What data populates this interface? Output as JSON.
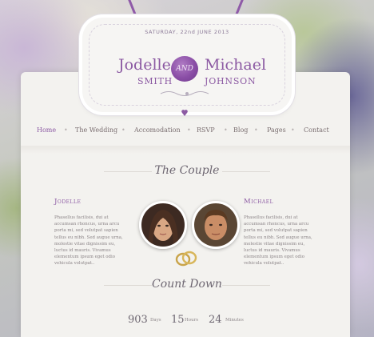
{
  "header": {
    "date": "SATURDAY, 22nd JUNE 2013",
    "bride_first": "Jodelle",
    "bride_last": "SMITH",
    "groom_first": "Michael",
    "groom_last": "JOHNSON",
    "seal_text": "AND",
    "accent_color": "#8c5aa3"
  },
  "nav": {
    "items": [
      "Home",
      "The Wedding",
      "Accomodation",
      "RSVP",
      "Blog",
      "Pages",
      "Contact"
    ],
    "separator": "•"
  },
  "couple": {
    "section_title": "The Couple",
    "bride": {
      "name": "Jodelle",
      "bio": "Phasellus facilisis, dui at accumsan rhoncus, urna arcu porta mi, sed volutpat sapien tellus eu nibh. Sed augue urna, molestie vitae dignissim eu, luctus id mauris. Vivamus elementum ipsum eget odio vehicula volutpat.."
    },
    "groom": {
      "name": "Michael",
      "bio": "Phasellus facilisis, dui at accumsan rhoncus, urna arcu porta mi, sed volutpat sapien tellus eu nibh. Sed augue urna, molestie vitae dignissim eu, luctus id mauris. Vivamus elementum ipsum eget odio vehicula volutpat.."
    }
  },
  "countdown": {
    "section_title": "Count Down",
    "days_value": "903",
    "days_label": "Days",
    "hours_value": "15",
    "hours_label": "Hours",
    "minutes_value": "24",
    "minutes_label": "Minutes"
  }
}
